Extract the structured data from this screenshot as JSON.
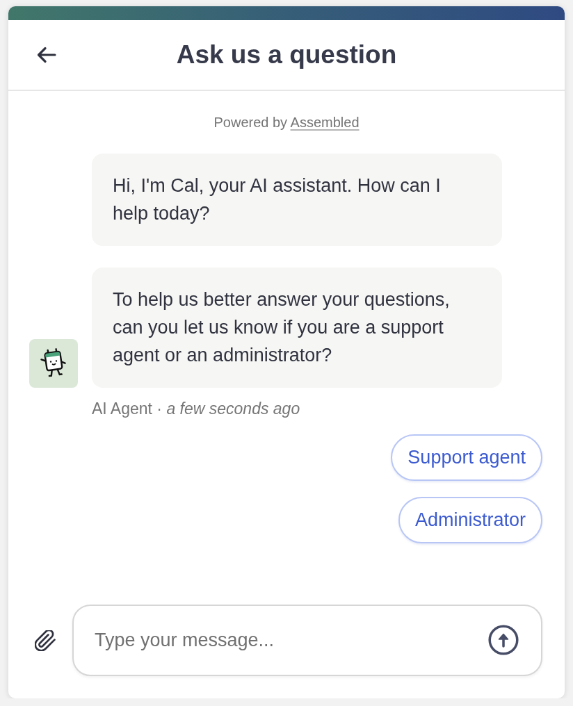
{
  "header": {
    "title": "Ask us a question"
  },
  "powered_by": {
    "text": "Powered by",
    "link": "Assembled"
  },
  "messages": [
    {
      "text": "Hi, I'm Cal, your AI assistant. How can I help today?",
      "avatar": false
    },
    {
      "text": "To help us better answer your questions, can you let us know if you are a support agent or an administrator?",
      "avatar": true
    }
  ],
  "meta": {
    "text": "AI Agent · *a few seconds ago*"
  },
  "quick_replies": [
    {
      "label": "Support agent"
    },
    {
      "label": "Administrator"
    }
  ],
  "composer": {
    "placeholder": "Type your message..."
  }
}
